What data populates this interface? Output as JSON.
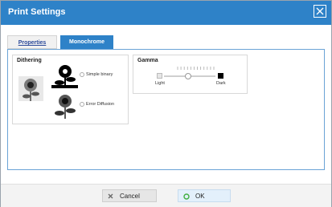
{
  "window": {
    "title": "Print Settings"
  },
  "tabs": [
    {
      "label": "Properties",
      "active": false
    },
    {
      "label": "Monochrome",
      "active": true
    }
  ],
  "dithering": {
    "label": "Dithering",
    "options": [
      {
        "label": "Simple binary",
        "selected": false
      },
      {
        "label": "Error Diffusion",
        "selected": false
      }
    ]
  },
  "gamma": {
    "label": "Gamma",
    "min_label": "Light",
    "max_label": "Dark",
    "value_fraction": 0.46,
    "ticks": 12
  },
  "buttons": {
    "cancel": "Cancel",
    "ok": "OK"
  },
  "colors": {
    "accent": "#2e82c8",
    "ok_icon": "#3fae3f"
  }
}
